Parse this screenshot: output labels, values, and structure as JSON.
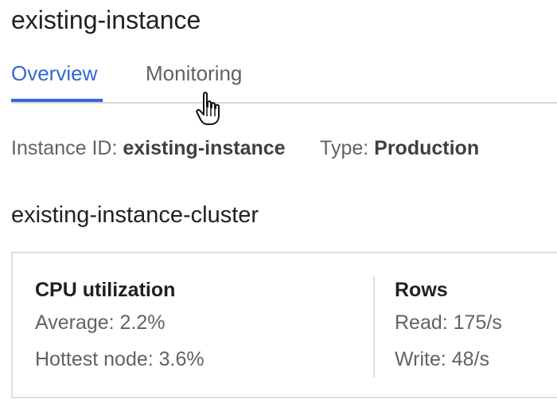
{
  "instance": {
    "title": "existing-instance"
  },
  "tabs": [
    {
      "label": "Overview",
      "active": true
    },
    {
      "label": "Monitoring",
      "active": false
    }
  ],
  "info": {
    "instance_id_label": "Instance ID:",
    "instance_id_value": "existing-instance",
    "type_label": "Type:",
    "type_value": "Production"
  },
  "cluster": {
    "title": "existing-instance-cluster",
    "cpu": {
      "heading": "CPU utilization",
      "average": "Average: 2.2%",
      "hottest": "Hottest node: 3.6%"
    },
    "rows": {
      "heading": "Rows",
      "read": "Read: 175/s",
      "write": "Write: 48/s"
    }
  },
  "colors": {
    "accent": "#3367d6",
    "tab_inactive": "#616161",
    "divider": "#d9d9d9"
  },
  "icons": {
    "cursor": "hand-pointer-icon"
  }
}
